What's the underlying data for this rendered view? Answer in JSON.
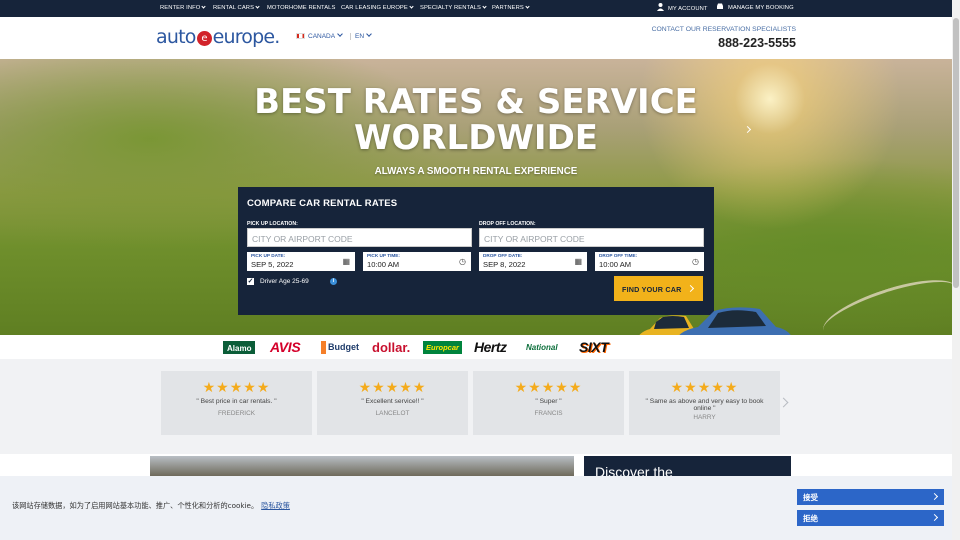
{
  "topnav": {
    "left": [
      {
        "label": "RENTER INFO",
        "dropdown": true
      },
      {
        "label": "RENTAL CARS",
        "dropdown": true
      },
      {
        "label": "MOTORHOME RENTALS",
        "dropdown": false
      },
      {
        "label": "CAR LEASING EUROPE",
        "dropdown": true
      },
      {
        "label": "SPECIALTY RENTALS",
        "dropdown": true
      },
      {
        "label": "PARTNERS",
        "dropdown": true
      }
    ],
    "my_account": "MY ACCOUNT",
    "manage_booking": "MANAGE MY BOOKING"
  },
  "header": {
    "logo_left": "auto",
    "logo_mark": "e",
    "logo_right": "europe.",
    "country": "CANADA",
    "language": "EN",
    "contact_label": "CONTACT OUR RESERVATION SPECIALISTS",
    "phone": "888-223-5555"
  },
  "hero": {
    "title_line1": "BEST RATES & SERVICE",
    "title_line2": "WORLDWIDE",
    "subtitle": "ALWAYS A SMOOTH RENTAL EXPERIENCE"
  },
  "form": {
    "title": "COMPARE CAR RENTAL RATES",
    "pickup_location_label": "PICK UP LOCATION:",
    "pickup_location_placeholder": "CITY OR AIRPORT CODE",
    "dropoff_location_label": "DROP OFF LOCATION:",
    "dropoff_location_placeholder": "CITY OR AIRPORT CODE",
    "pickup_date_label": "PICK UP DATE:",
    "pickup_date": "SEP 5, 2022",
    "pickup_time_label": "PICK UP TIME:",
    "pickup_time": "10:00 AM",
    "dropoff_date_label": "DROP OFF DATE:",
    "dropoff_date": "SEP 8, 2022",
    "dropoff_time_label": "DROP OFF TIME:",
    "dropoff_time": "10:00 AM",
    "driver_age": "Driver Age 25-69",
    "driver_age_checked": true,
    "submit": "FIND YOUR CAR"
  },
  "brands": [
    "Alamo",
    "AVIS",
    "Budget",
    "dollar.",
    "Europcar",
    "Hertz",
    "National",
    "SIXT"
  ],
  "reviews": [
    {
      "stars": 5,
      "text": "\" Best price in car rentals. \"",
      "name": "FREDERICK"
    },
    {
      "stars": 5,
      "text": "\" Excellent service!! \"",
      "name": "LANCELOT"
    },
    {
      "stars": 5,
      "text": "\" Super \"",
      "name": "FRANCIS"
    },
    {
      "stars": 5,
      "text": "\" Same as above and very easy to book online \"",
      "name": "HARRY"
    }
  ],
  "discover": "Discover the",
  "cookie": {
    "text": "该网站存储数据，如为了启用网站基本功能、推广、个性化和分析的cookie。",
    "link": "隐私政策",
    "accept": "接受",
    "reject": "拒绝"
  },
  "colors": {
    "navy": "#16243a",
    "brand_blue": "#2c57a0",
    "cta": "#f2b21a",
    "star": "#f4ab1c",
    "cookie_button": "#2c66c8"
  },
  "icons": {
    "account": "user-icon",
    "booking": "car-icon",
    "date": "calendar-icon",
    "time": "clock-icon",
    "info": "info-icon"
  }
}
